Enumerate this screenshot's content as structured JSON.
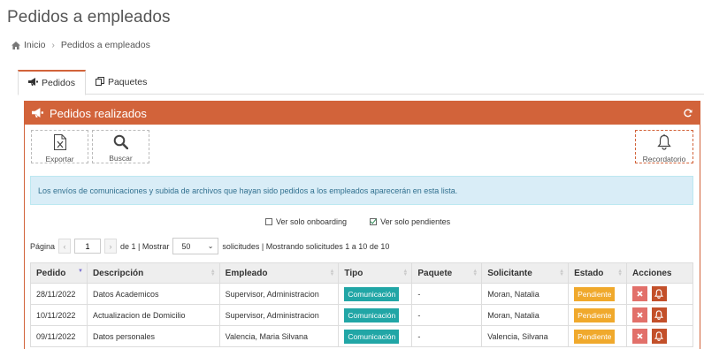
{
  "page": {
    "title": "Pedidos a empleados"
  },
  "breadcrumb": {
    "home": "Inicio",
    "current": "Pedidos a empleados"
  },
  "tabs": [
    {
      "label": "Pedidos",
      "active": true
    },
    {
      "label": "Paquetes",
      "active": false
    }
  ],
  "panel": {
    "title": "Pedidos realizados"
  },
  "toolbar": {
    "export_label": "Exportar",
    "search_label": "Buscar",
    "reminder_label": "Recordatorio"
  },
  "info": "Los envíos de comunicaciones y subida de archivos que hayan sido pedidos a los empleados aparecerán en esta lista.",
  "filters": {
    "onboarding_label": "Ver solo onboarding",
    "onboarding_checked": false,
    "pending_label": "Ver solo pendientes",
    "pending_checked": true
  },
  "pager": {
    "page_label": "Página",
    "current_page": "1",
    "of_total": "de 1 | Mostrar",
    "per_page": "50",
    "summary": "solicitudes | Mostrando solicitudes 1 a 10 de 10"
  },
  "table": {
    "headers": [
      "Pedido",
      "Descripción",
      "Empleado",
      "Tipo",
      "Paquete",
      "Solicitante",
      "Estado",
      "Acciones"
    ],
    "rows": [
      {
        "pedido": "28/11/2022",
        "descripcion": "Datos Academicos",
        "empleado": "Supervisor, Administracion",
        "tipo": "Comunicación",
        "paquete": "-",
        "solicitante": "Moran, Natalia",
        "estado": "Pendiente"
      },
      {
        "pedido": "10/11/2022",
        "descripcion": "Actualizacion de Domicilio",
        "empleado": "Supervisor, Administracion",
        "tipo": "Comunicación",
        "paquete": "-",
        "solicitante": "Moran, Natalia",
        "estado": "Pendiente"
      },
      {
        "pedido": "09/11/2022",
        "descripcion": "Datos personales",
        "empleado": "Valencia, Maria Silvana",
        "tipo": "Comunicación",
        "paquete": "-",
        "solicitante": "Valencia, Silvana",
        "estado": "Pendiente"
      }
    ]
  },
  "colors": {
    "accent": "#d2633a",
    "info_bg": "#d9edf7",
    "tipo_badge": "#21a6a6",
    "estado_badge": "#f0a92c",
    "delete": "#e2706a",
    "bell": "#c3502a"
  },
  "icons": {
    "home": "home-icon",
    "tab_pedidos": "megaphone-icon",
    "tab_paquetes": "copy-icon",
    "panel": "megaphone-icon",
    "refresh": "refresh-icon",
    "export": "excel-file-icon",
    "search": "search-icon",
    "reminder": "bell-icon",
    "delete": "close-icon"
  }
}
